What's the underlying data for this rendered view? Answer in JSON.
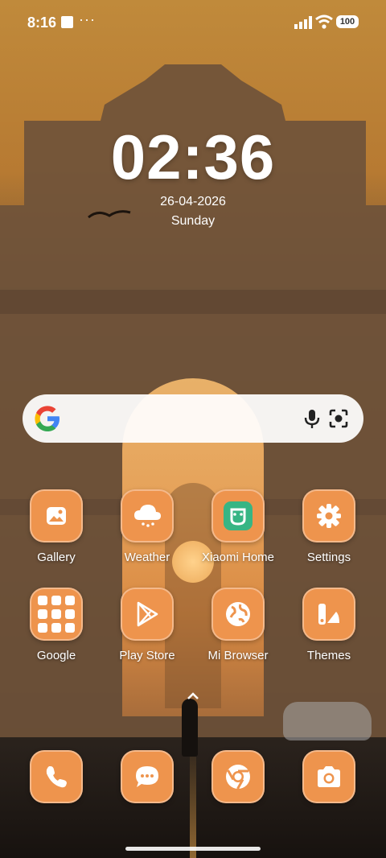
{
  "status_bar": {
    "time": "8:16",
    "more": "···",
    "battery": "100"
  },
  "clock": {
    "time": "02:36",
    "date": "26-04-2026",
    "weekday": "Sunday"
  },
  "search": {
    "logo": "google-g-icon",
    "mic": "microphone-icon",
    "lens": "lens-icon"
  },
  "apps": {
    "row1": [
      {
        "label": "Gallery",
        "icon": "gallery-icon"
      },
      {
        "label": "Weather",
        "icon": "weather-icon"
      },
      {
        "label": "Xiaomi Home",
        "icon": "xiaomi-home-icon"
      },
      {
        "label": "Settings",
        "icon": "gear-icon"
      }
    ],
    "row2": [
      {
        "label": "Google",
        "icon": "google-folder-icon"
      },
      {
        "label": "Play Store",
        "icon": "play-store-icon"
      },
      {
        "label": "Mi Browser",
        "icon": "globe-icon"
      },
      {
        "label": "Themes",
        "icon": "themes-icon"
      }
    ]
  },
  "dock": [
    {
      "icon": "phone-icon"
    },
    {
      "icon": "messages-icon"
    },
    {
      "icon": "chrome-icon"
    },
    {
      "icon": "camera-icon"
    }
  ],
  "colors": {
    "app_icon_bg": "#ee944d",
    "search_bg": "#ffffff"
  }
}
